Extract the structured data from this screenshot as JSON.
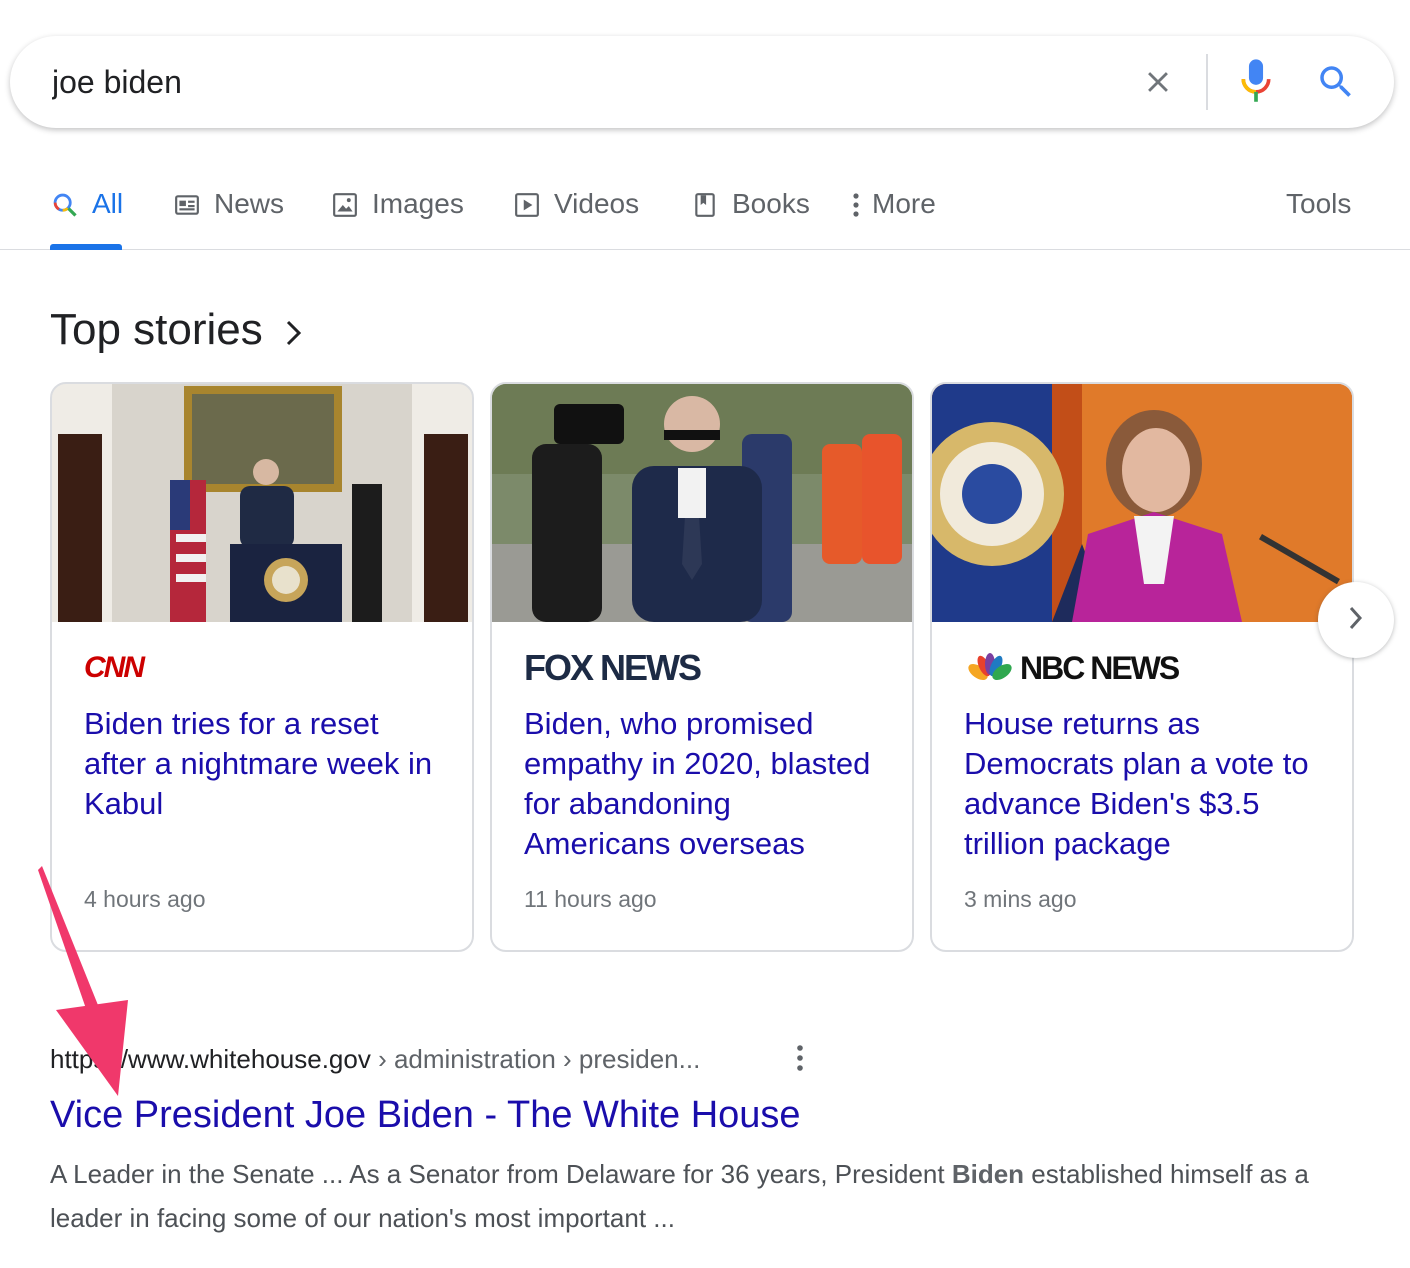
{
  "search": {
    "query": "joe biden",
    "clear_icon": "close-icon",
    "mic_icon": "microphone-icon",
    "search_icon": "search-icon"
  },
  "tabs": [
    {
      "label": "All",
      "icon": "search-icon",
      "active": true
    },
    {
      "label": "News",
      "icon": "news-icon"
    },
    {
      "label": "Images",
      "icon": "image-icon"
    },
    {
      "label": "Videos",
      "icon": "video-icon"
    },
    {
      "label": "Books",
      "icon": "book-icon"
    },
    {
      "label": "More",
      "icon": "more-vert-icon"
    },
    {
      "label": "Tools"
    }
  ],
  "top_stories": {
    "title": "Top stories",
    "cards": [
      {
        "source": "CNN",
        "headline": "Biden tries for a reset after a nightmare week in Kabul",
        "time": "4 hours ago"
      },
      {
        "source": "FOX NEWS",
        "headline": "Biden, who promised empathy in 2020, blasted for abandoning Americans overseas",
        "time": "11 hours ago"
      },
      {
        "source": "NBC NEWS",
        "headline": "House returns as Democrats plan a vote to advance Biden's $3.5 trillion package",
        "time": "3 mins ago"
      }
    ]
  },
  "result": {
    "url_host": "https://www.whitehouse.gov",
    "url_path": " › administration › presiden...",
    "title": "Vice President Joe Biden - The White House",
    "snippet_before": "A Leader in the Senate ... As a Senator from Delaware for 36 years, President ",
    "snippet_bold": "Biden",
    "snippet_after": " established himself as a leader in facing some of our nation's most important ..."
  },
  "colors": {
    "link": "#1a0dab",
    "active_tab": "#1a73e8",
    "annotation_arrow": "#f0386b"
  }
}
